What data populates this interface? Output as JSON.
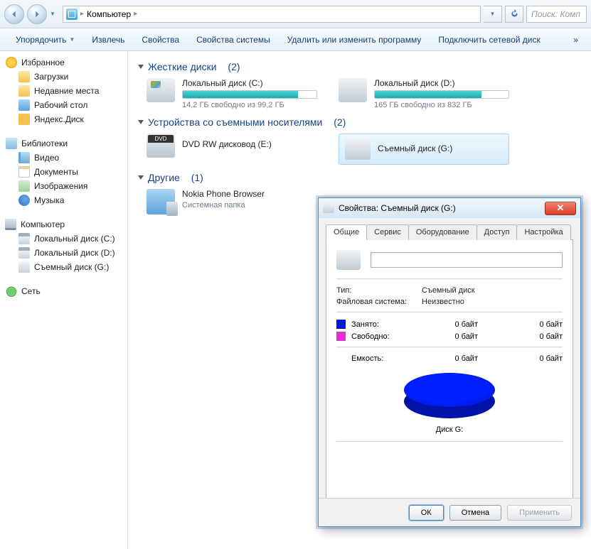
{
  "address": {
    "location": "Компьютер"
  },
  "search": {
    "placeholder": "Поиск: Комп"
  },
  "toolbar": {
    "organize": "Упорядочить",
    "extract": "Извлечь",
    "properties": "Свойства",
    "system_properties": "Свойства системы",
    "uninstall": "Удалить или изменить программу",
    "map_drive": "Подключить сетевой диск",
    "overflow": "»"
  },
  "sidebar": {
    "favorites": {
      "label": "Избранное",
      "items": [
        "Загрузки",
        "Недавние места",
        "Рабочий стол",
        "Яндекс.Диск"
      ]
    },
    "libraries": {
      "label": "Библиотеки",
      "items": [
        "Видео",
        "Документы",
        "Изображения",
        "Музыка"
      ]
    },
    "computer": {
      "label": "Компьютер",
      "items": [
        "Локальный диск (C:)",
        "Локальный диск (D:)",
        "Съемный диск (G:)"
      ]
    },
    "network": {
      "label": "Сеть"
    }
  },
  "sections": {
    "hdd": {
      "title": "Жесткие диски",
      "count": "(2)"
    },
    "remov": {
      "title": "Устройства со съемными носителями",
      "count": "(2)"
    },
    "other": {
      "title": "Другие",
      "count": "(1)"
    }
  },
  "drives": {
    "c": {
      "name": "Локальный диск (C:)",
      "capacity_text": "14,2 ГБ свободно из 99,2 ГБ",
      "fill_pct": 86
    },
    "d": {
      "name": "Локальный диск (D:)",
      "capacity_text": "165 ГБ свободно из 832 ГБ",
      "fill_pct": 80
    },
    "dvd": {
      "name": "DVD RW дисковод (E:)"
    },
    "g": {
      "name": "Съемный диск (G:)"
    }
  },
  "other_items": [
    {
      "name": "Nokia Phone Browser",
      "sub": "Системная папка"
    }
  ],
  "dialog": {
    "title": "Свойства: Съемный диск (G:)",
    "tabs": [
      "Общие",
      "Сервис",
      "Оборудование",
      "Доступ",
      "Настройка"
    ],
    "name_value": "",
    "fields": {
      "type_label": "Тип:",
      "type_value": "Съемный диск",
      "fs_label": "Файловая система:",
      "fs_value": "Неизвестно"
    },
    "usage": {
      "used_label": "Занято:",
      "used_v1": "0 байт",
      "used_v2": "0 байт",
      "free_label": "Свободно:",
      "free_v1": "0 байт",
      "free_v2": "0 байт",
      "cap_label": "Емкость:",
      "cap_v1": "0 байт",
      "cap_v2": "0 байт"
    },
    "disk_label": "Диск G:",
    "buttons": {
      "ok": "ОК",
      "cancel": "Отмена",
      "apply": "Применить"
    }
  },
  "chart_data": {
    "type": "pie",
    "title": "Диск G:",
    "series": [
      {
        "name": "Занято",
        "value": 0,
        "unit": "байт",
        "color": "#0017d4"
      },
      {
        "name": "Свободно",
        "value": 0,
        "unit": "байт",
        "color": "#e32ed1"
      }
    ],
    "capacity": {
      "value": 0,
      "unit": "байт"
    }
  }
}
